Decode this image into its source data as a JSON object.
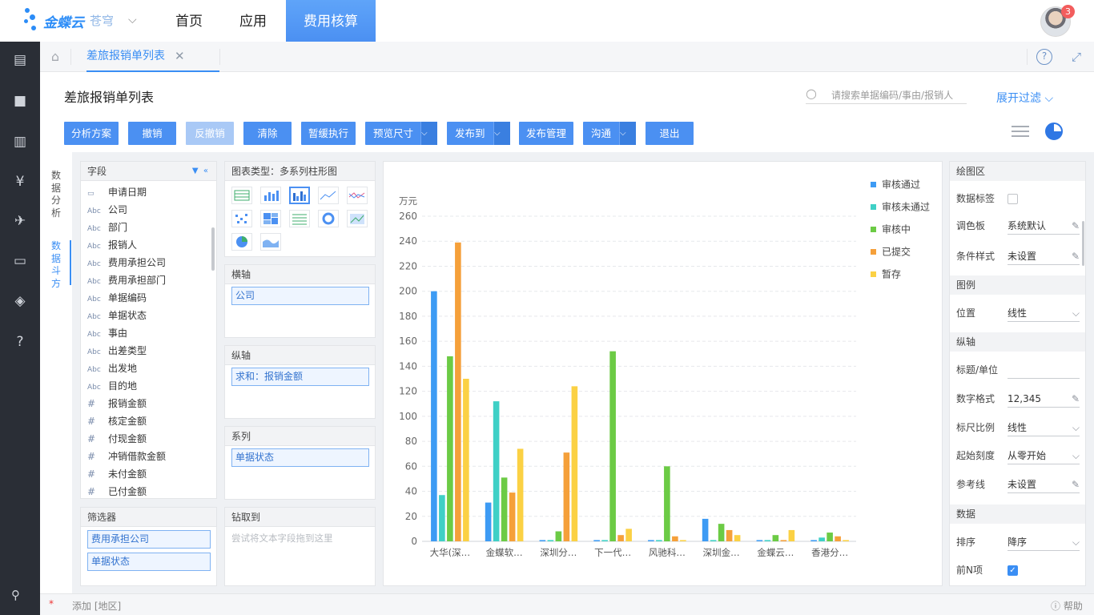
{
  "topbar": {
    "brand": "金蝶云",
    "brand_sub": "苍穹",
    "nav": [
      "首页",
      "应用",
      "费用核算"
    ],
    "notification_count": "3"
  },
  "tabs": {
    "active_label": "差旅报销单列表"
  },
  "page": {
    "title": "差旅报销单列表",
    "search_placeholder": "请搜索单据编码/事由/报销人",
    "expand_filter": "展开过滤"
  },
  "toolbar": [
    "分析方案",
    "撤销",
    "反撤销",
    "清除",
    "暂缓执行",
    "预览尺寸",
    "发布到",
    "发布管理",
    "沟通",
    "退出"
  ],
  "side_tabs": [
    "数据分析",
    "数据斗方"
  ],
  "fields_panel": {
    "title": "字段",
    "items": [
      {
        "type": "date",
        "label": "申请日期"
      },
      {
        "type": "Abc",
        "label": "公司"
      },
      {
        "type": "Abc",
        "label": "部门"
      },
      {
        "type": "Abc",
        "label": "报销人"
      },
      {
        "type": "Abc",
        "label": "费用承担公司"
      },
      {
        "type": "Abc",
        "label": "费用承担部门"
      },
      {
        "type": "Abc",
        "label": "单据编码"
      },
      {
        "type": "Abc",
        "label": "单据状态"
      },
      {
        "type": "Abc",
        "label": "事由"
      },
      {
        "type": "Abc",
        "label": "出差类型"
      },
      {
        "type": "Abc",
        "label": "出发地"
      },
      {
        "type": "Abc",
        "label": "目的地"
      },
      {
        "type": "#",
        "label": "报销金额"
      },
      {
        "type": "#",
        "label": "核定金额"
      },
      {
        "type": "#",
        "label": "付现金额"
      },
      {
        "type": "#",
        "label": "冲销借款金额"
      },
      {
        "type": "#",
        "label": "未付金额"
      },
      {
        "type": "#",
        "label": "已付金额"
      }
    ]
  },
  "chart_type_panel": {
    "title": "图表类型：多系列柱形图"
  },
  "xaxis_panel": {
    "title": "横轴",
    "value": "公司"
  },
  "yaxis_panel": {
    "title": "纵轴",
    "value": "求和：报销金额"
  },
  "series_panel": {
    "title": "系列",
    "value": "单据状态"
  },
  "filter_panel": {
    "title": "筛选器",
    "items": [
      "费用承担公司",
      "单据状态"
    ]
  },
  "drill_panel": {
    "title": "钻取到",
    "placeholder": "尝试将文本字段拖到这里"
  },
  "props": {
    "sec_plot": "绘图区",
    "data_label": "数据标签",
    "palette_label": "调色板",
    "palette_value": "系统默认",
    "cond_label": "条件样式",
    "cond_value": "未设置",
    "sec_legend": "图例",
    "legend_pos_label": "位置",
    "legend_pos_value": "线性",
    "sec_yaxis": "纵轴",
    "title_unit_label": "标题/单位",
    "title_unit_value": "",
    "num_fmt_label": "数字格式",
    "num_fmt_value": "12,345",
    "scale_label": "标尺比例",
    "scale_value": "线性",
    "start_label": "起始刻度",
    "start_value": "从零开始",
    "ref_label": "参考线",
    "ref_value": "未设置",
    "sec_data": "数据",
    "sort_label": "排序",
    "sort_value": "降序",
    "topn_label": "前N项"
  },
  "footer": {
    "add_label": "添加 [地区]",
    "help": "帮助"
  },
  "colors": {
    "accent": "#3a8ef4",
    "button": "#4b90f2",
    "rail": "#2a2e36"
  },
  "chart_data": {
    "type": "bar",
    "ylabel": "万元",
    "ylim": [
      0,
      260
    ],
    "yticks": [
      0,
      20,
      40,
      60,
      80,
      100,
      120,
      140,
      160,
      180,
      200,
      220,
      240,
      260
    ],
    "categories": [
      "大华(深…",
      "金蝶软…",
      "深圳分…",
      "下一代…",
      "风驰科…",
      "深圳金…",
      "金蝶云…",
      "香港分…"
    ],
    "grid": true,
    "legend": "right",
    "series": [
      {
        "name": "审核通过",
        "color": "#3d9bf4",
        "values": [
          200,
          31,
          1,
          1,
          1,
          18,
          1,
          1
        ]
      },
      {
        "name": "审核未通过",
        "color": "#3fd0c6",
        "values": [
          37,
          112,
          1,
          1,
          1,
          1,
          1,
          3
        ]
      },
      {
        "name": "审核中",
        "color": "#6ccb45",
        "values": [
          148,
          51,
          8,
          152,
          60,
          14,
          5,
          7
        ]
      },
      {
        "name": "已提交",
        "color": "#f5a03a",
        "values": [
          239,
          39,
          71,
          5,
          4,
          9,
          1,
          4
        ]
      },
      {
        "name": "暂存",
        "color": "#fbd144",
        "values": [
          130,
          74,
          124,
          10,
          1,
          5,
          9,
          1
        ]
      }
    ]
  }
}
